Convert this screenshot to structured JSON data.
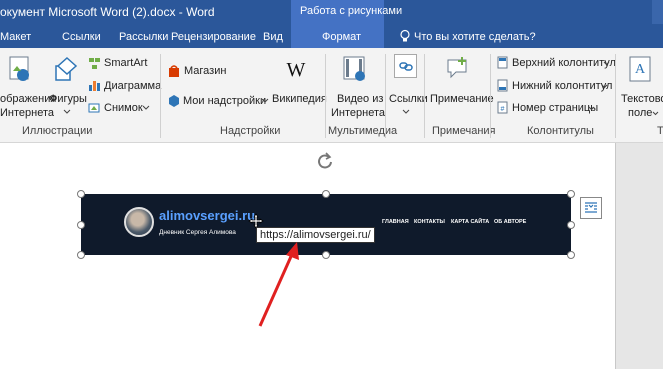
{
  "window": {
    "title": "окумент Microsoft Word (2).docx  -  Word",
    "context_tab_title": "Работа с рисунками"
  },
  "tabs": [
    "Макет",
    "Ссылки",
    "Рассылки",
    "Рецензирование",
    "Вид",
    "Формат"
  ],
  "tell_me": {
    "placeholder": "Что вы хотите сделать?",
    "icon": "lightbulb-icon"
  },
  "ribbon": {
    "illustrations": {
      "images_label_1": "ображения",
      "images_label_2": "Интернета",
      "shapes_label": "Фигуры",
      "smartart_label": "SmartArt",
      "chart_label": "Диаграмма",
      "screenshot_label": "Снимок",
      "group_label": "Иллюстрации"
    },
    "addins": {
      "store_label": "Магазин",
      "my_addins_label": "Мои надстройки",
      "wikipedia_label": "Википедия",
      "group_label": "Надстройки"
    },
    "media": {
      "video_label_1": "Видео из",
      "video_label_2": "Интернета",
      "group_label": "Мультимедиа"
    },
    "links": {
      "links_label": "Ссылки"
    },
    "comments": {
      "comment_label": "Примечание",
      "group_label": "Примечания"
    },
    "header_footer": {
      "header_label": "Верхний колонтитул",
      "footer_label": "Нижний колонтитул",
      "page_number_label": "Номер страницы",
      "group_label": "Колонтитулы"
    },
    "text": {
      "textbox_label_1": "Текстовое",
      "textbox_label_2": "поле",
      "group_label": "Т"
    }
  },
  "document": {
    "banner": {
      "site_name": "alimovsergei.ru",
      "site_subtitle": "Дневник Сергея Алимова",
      "nav": [
        "ГЛАВНАЯ",
        "КОНТАКТЫ",
        "КАРТА САЙТА",
        "ОБ АВТОРЕ"
      ]
    },
    "tooltip": "https://alimovsergei.ru/"
  },
  "colors": {
    "titlebar": "#2b579a",
    "context_tab": "#4472c4",
    "banner_bg": "#0f1a2b",
    "site_name": "#5aa0ff",
    "arrow": "#e02020"
  }
}
